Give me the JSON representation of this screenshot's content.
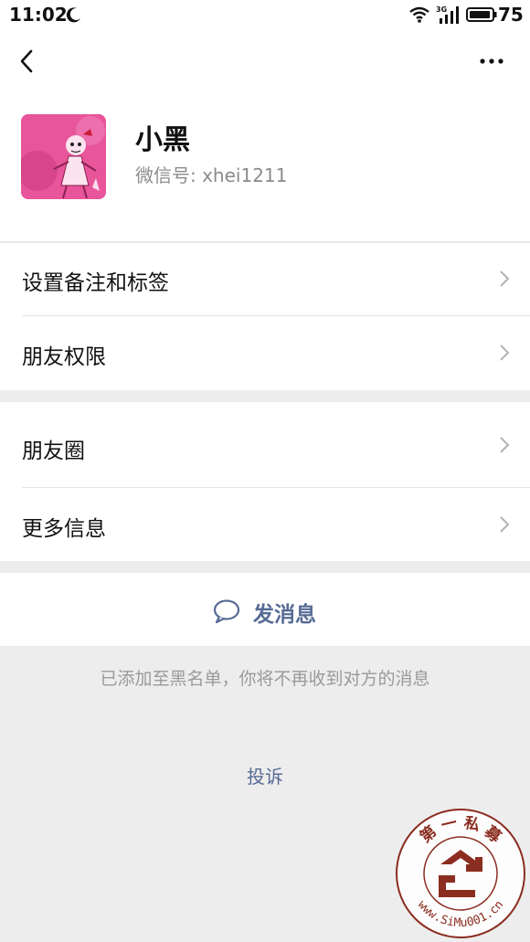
{
  "status_bar": {
    "time": "11:02",
    "battery": "75",
    "network": "3G"
  },
  "profile": {
    "name": "小黑",
    "wechat_id": "微信号: xhei1211"
  },
  "menu_group_1": [
    {
      "label": "设置备注和标签"
    },
    {
      "label": "朋友权限"
    }
  ],
  "menu_group_2": [
    {
      "label": "朋友圈"
    },
    {
      "label": "更多信息"
    }
  ],
  "actions": {
    "send_message": "发消息"
  },
  "notice": "已添加至黑名单，你将不再收到对方的消息",
  "report": "投诉",
  "watermark": {
    "top_text": "第 一 私 募",
    "bottom_text": "www.SiMu001.cn"
  },
  "colors": {
    "link": "#576b95",
    "background": "#ededed",
    "avatar": "#e8559a"
  }
}
